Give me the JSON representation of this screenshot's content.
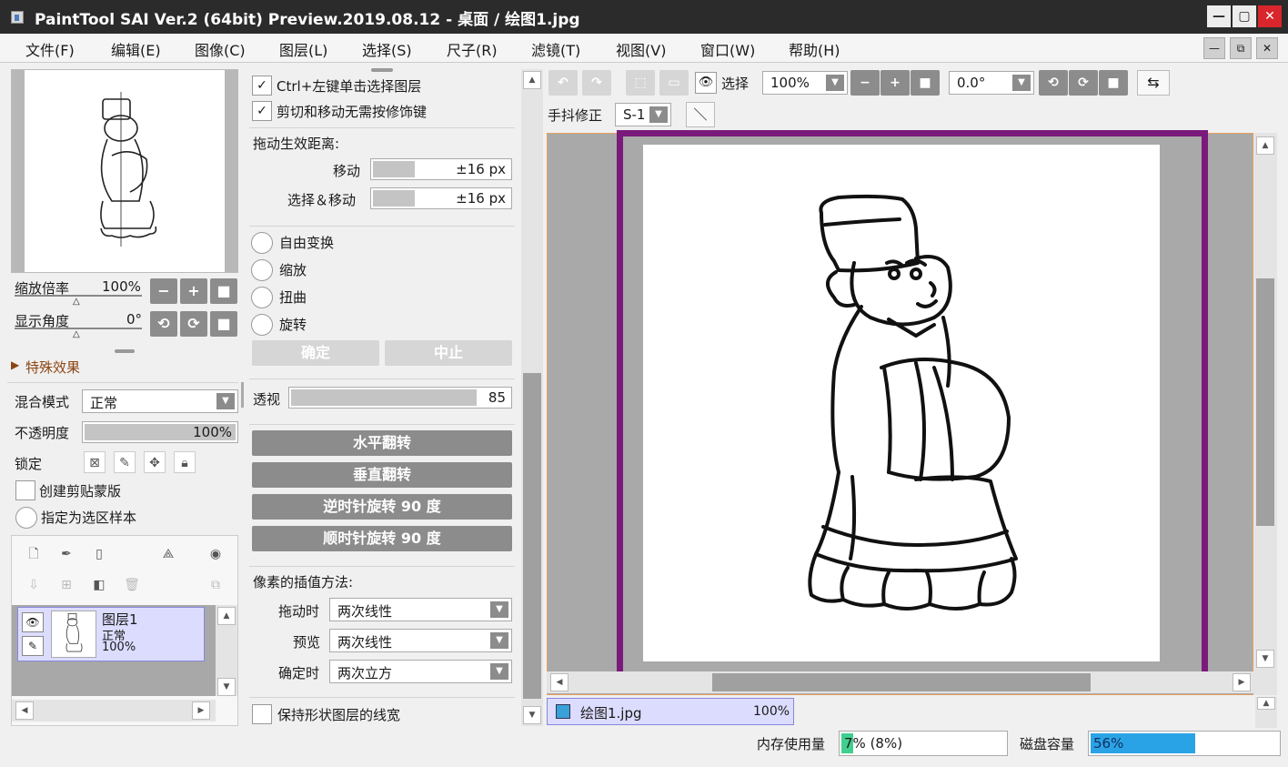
{
  "window": {
    "title": "PaintTool SAI Ver.2 (64bit) Preview.2019.08.12 - 桌面 / 绘图1.jpg",
    "min": "—",
    "max": "▢",
    "close": "✕"
  },
  "menu": [
    "文件(F)",
    "编辑(E)",
    "图像(C)",
    "图层(L)",
    "选择(S)",
    "尺子(R)",
    "滤镜(T)",
    "视图(V)",
    "窗口(W)",
    "帮助(H)"
  ],
  "mdi": {
    "min": "—",
    "restore": "⧉",
    "close": "✕"
  },
  "navigator": {
    "zoom_label": "缩放倍率",
    "zoom_value": "100%",
    "angle_label": "显示角度",
    "angle_value": "0°",
    "btn_minus": "−",
    "btn_plus": "+",
    "btn_reset": "■",
    "btn_rot_ccw": "⟲",
    "btn_rot_cw": "⟳"
  },
  "effects": {
    "label": "特殊效果"
  },
  "layer_props": {
    "blend_label": "混合模式",
    "blend_value": "正常",
    "opacity_label": "不透明度",
    "opacity_value": "100%",
    "opacity_fraction": 1.0,
    "lock_label": "锁定",
    "clip_label": "创建剪贴蒙版",
    "sample_label": "指定为选区样本"
  },
  "layers": [
    {
      "name": "图层1",
      "mode": "正常",
      "opacity": "100%"
    }
  ],
  "transform": {
    "opt1": "Ctrl+左键单击选择图层",
    "opt2": "剪切和移动无需按修饰键",
    "drag_dist_label": "拖动生效距离:",
    "move_label": "移动",
    "move_value": "±16 px",
    "selmove_label": "选择＆移动",
    "selmove_value": "±16 px",
    "modes": [
      "自由变换",
      "缩放",
      "扭曲",
      "旋转"
    ],
    "ok": "确定",
    "cancel": "中止",
    "persp_label": "透视",
    "persp_value": "85",
    "persp_fraction": 0.85,
    "flip_h": "水平翻转",
    "flip_v": "垂直翻转",
    "rot_ccw": "逆时针旋转 90 度",
    "rot_cw": "顺时针旋转 90 度",
    "interp_label": "像素的插值方法:",
    "drag_label": "拖动时",
    "drag_value": "两次线性",
    "preview_label": "预览",
    "preview_value": "两次线性",
    "confirm_label": "确定时",
    "confirm_value": "两次立方",
    "keep_stroke": "保持形状图层的线宽"
  },
  "toolbar": {
    "select_label": "选择",
    "zoom_value": "100%",
    "angle_value": "0.0°",
    "stab_label": "手抖修正",
    "stab_value": "S-1"
  },
  "canvas_tab": {
    "name": "绘图1.jpg",
    "zoom": "100%"
  },
  "status": {
    "mem_label": "内存使用量",
    "mem_value": "7% (8%)",
    "mem_fraction": 0.07,
    "disk_label": "磁盘容量",
    "disk_value": "56%",
    "disk_fraction": 0.56
  },
  "colors": {
    "frame": "#7a1a7a",
    "accent": "#3b6fd0",
    "mem_fill": "#3fcf8e",
    "disk_fill": "#2aa3e6"
  }
}
